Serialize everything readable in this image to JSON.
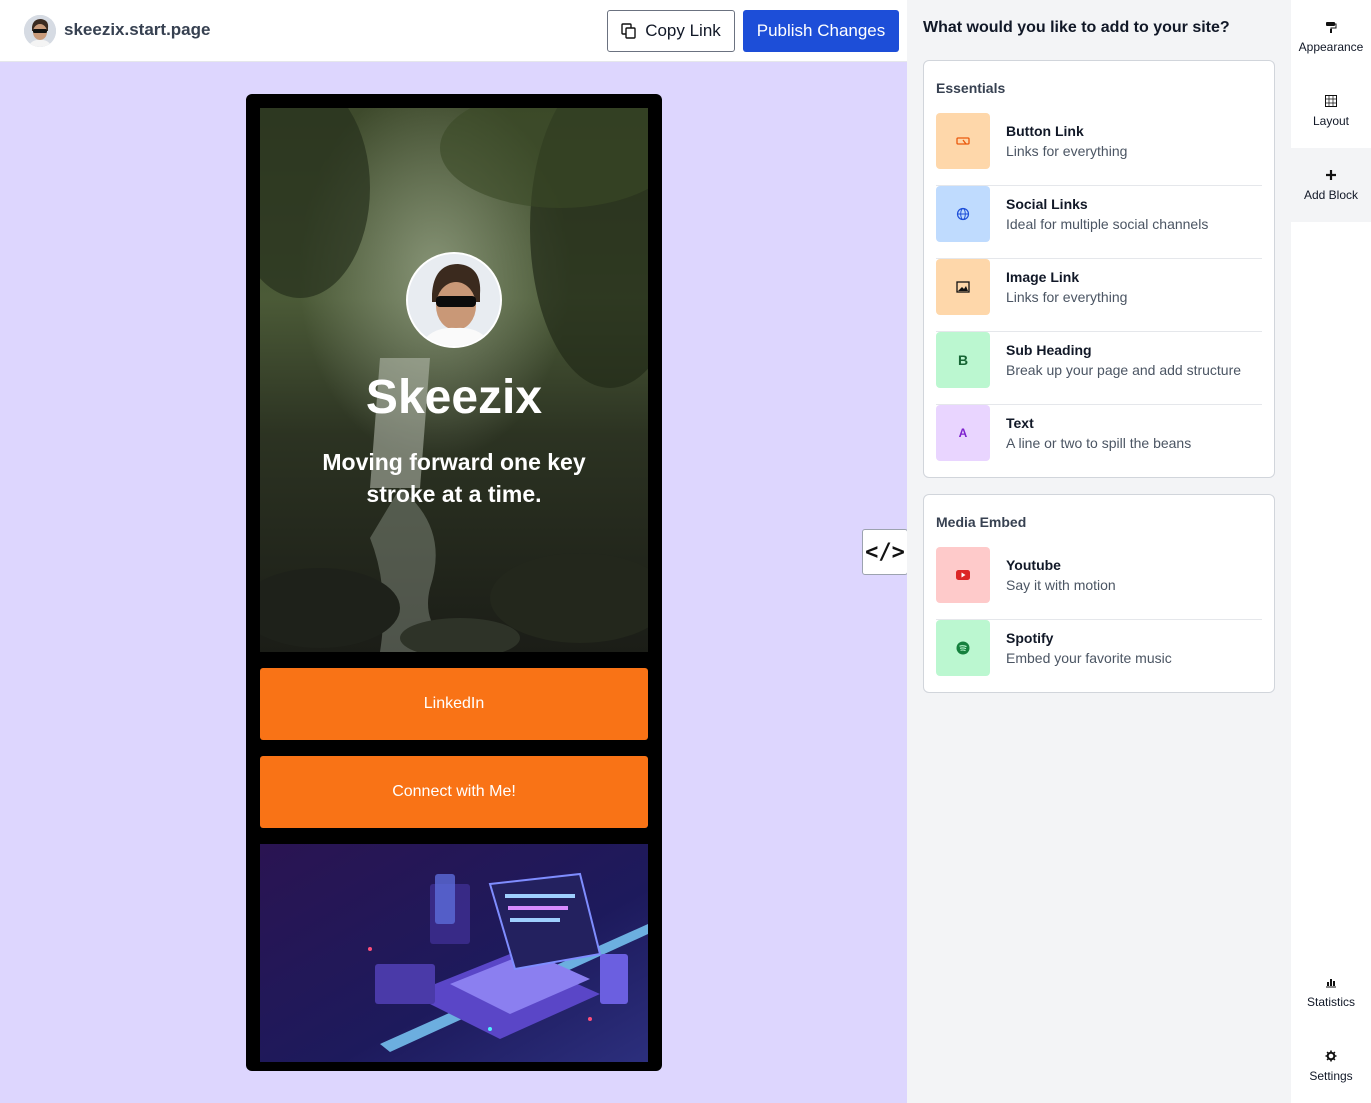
{
  "header": {
    "site_title": "skeezix.start.page",
    "copy_link_label": "Copy Link",
    "publish_label": "Publish Changes"
  },
  "preview": {
    "profile": {
      "name": "Skeezix",
      "bio": "Moving forward one key stroke at a time."
    },
    "links": [
      {
        "label": "LinkedIn"
      },
      {
        "label": "Connect with Me!"
      }
    ],
    "link_color": "#f97316",
    "canvas_color": "#ddd6fe",
    "embed_toggle_label": "</>"
  },
  "panel": {
    "title": "What would you like to add to your site?",
    "essentials": {
      "heading": "Essentials",
      "items": [
        {
          "name": "Button Link",
          "desc": "Links for everything",
          "icon": "button-link-icon",
          "color": "#fed7aa"
        },
        {
          "name": "Social Links",
          "desc": "Ideal for multiple social channels",
          "icon": "globe-icon",
          "color": "#bfdbfe"
        },
        {
          "name": "Image Link",
          "desc": "Links for everything",
          "icon": "image-icon",
          "color": "#fed7aa"
        },
        {
          "name": "Sub Heading",
          "desc": "Break up your page and add structure",
          "icon": "heading-icon",
          "color": "#bbf7d0"
        },
        {
          "name": "Text",
          "desc": "A line or two to spill the beans",
          "icon": "text-icon",
          "color": "#e9d5ff"
        }
      ]
    },
    "media": {
      "heading": "Media Embed",
      "items": [
        {
          "name": "Youtube",
          "desc": "Say it with motion",
          "icon": "youtube-icon",
          "color": "#fecaca"
        },
        {
          "name": "Spotify",
          "desc": "Embed your favorite music",
          "icon": "spotify-icon",
          "color": "#bbf7d0"
        }
      ]
    }
  },
  "sidebar": {
    "appearance": "Appearance",
    "layout": "Layout",
    "add_block": "Add Block",
    "statistics": "Statistics",
    "settings": "Settings"
  },
  "icon_glyphs": {
    "heading": "B",
    "text": "A"
  },
  "brand_color": "#1d4ed8"
}
